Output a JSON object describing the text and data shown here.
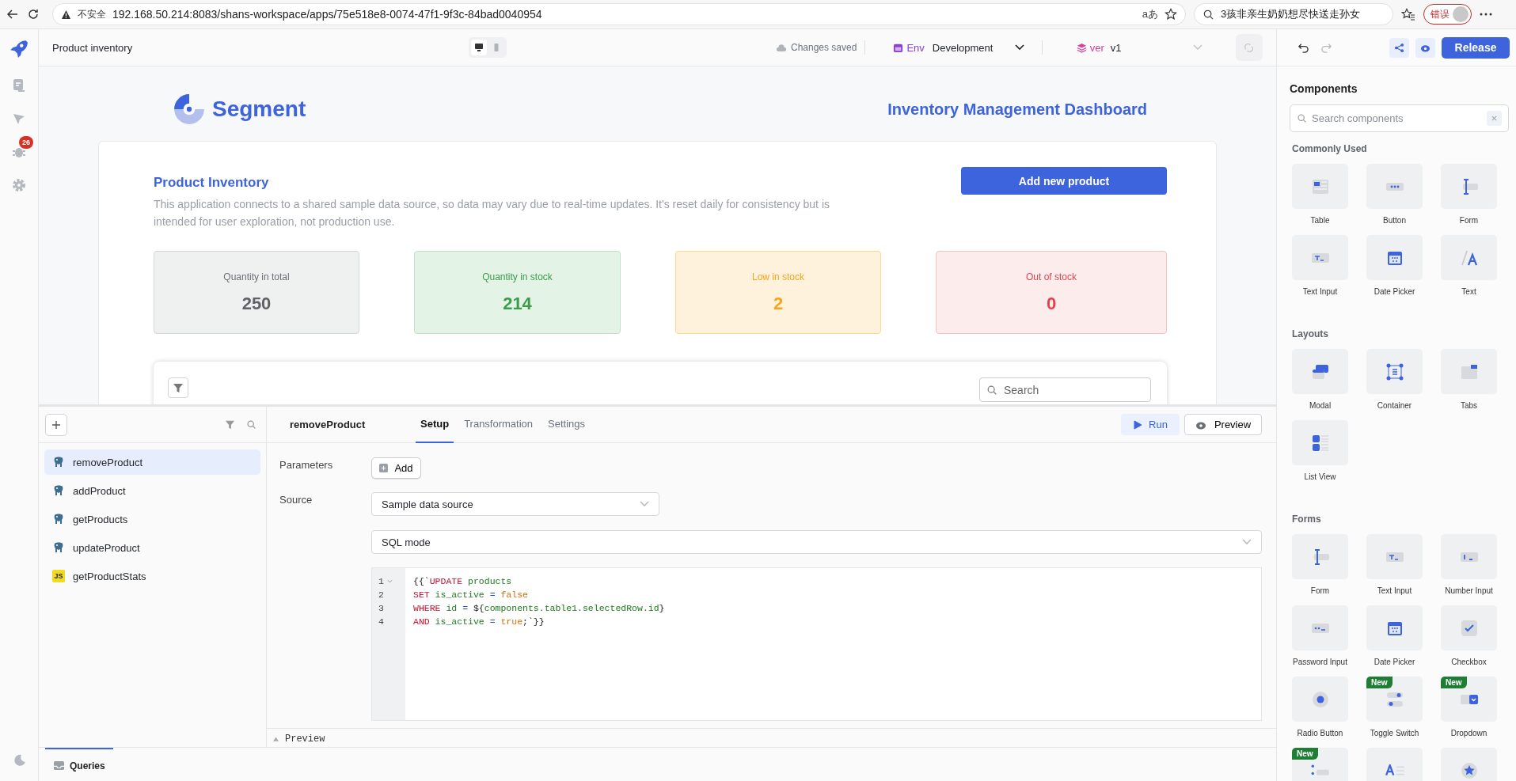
{
  "browser": {
    "security_label": "不安全",
    "url": "192.168.50.214:8083/shans-workspace/apps/75e518e8-0074-47f1-9f3c-84bad0040954",
    "reader_glyph": "aあ",
    "search_text": "3孩非亲生奶奶想尽快送走孙女",
    "profile_label": "错误"
  },
  "header": {
    "app_name": "Product inventory",
    "devices": [
      {
        "kind": "desktop",
        "selected": true
      },
      {
        "kind": "mobile",
        "selected": false
      }
    ],
    "save_status": "Changes saved",
    "env_label": "Env",
    "env_value": "Development",
    "version_label": "ver",
    "version_value": "v1",
    "release": "Release"
  },
  "rail": {
    "badge": "26"
  },
  "canvas": {
    "brand": "Segment",
    "dashboard_title": "Inventory Management Dashboard",
    "section_title": "Product Inventory",
    "description": "This application connects to a shared sample data source, so data may vary due to real-time updates. It's reset daily for consistency but is intended for user exploration, not production use.",
    "add_button": "Add new product",
    "stats": [
      {
        "kind": "neutral",
        "label": "Quantity in total",
        "value": "250"
      },
      {
        "kind": "success",
        "label": "Quantity in stock",
        "value": "214"
      },
      {
        "kind": "warning",
        "label": "Low in stock",
        "value": "2"
      },
      {
        "kind": "danger",
        "label": "Out of stock",
        "value": "0"
      }
    ],
    "search_placeholder": "Search"
  },
  "queries": {
    "items": [
      {
        "kind": "postgres",
        "name": "removeProduct",
        "selected": true
      },
      {
        "kind": "postgres",
        "name": "addProduct",
        "selected": false
      },
      {
        "kind": "postgres",
        "name": "getProducts",
        "selected": false
      },
      {
        "kind": "postgres",
        "name": "updateProduct",
        "selected": false
      },
      {
        "kind": "js",
        "icon_label": "JS",
        "name": "getProductStats",
        "selected": false
      }
    ],
    "active_query": "removeProduct",
    "tabs": [
      {
        "label": "Setup",
        "selected": true
      },
      {
        "label": "Transformation",
        "selected": false
      },
      {
        "label": "Settings",
        "selected": false
      }
    ],
    "run": "Run",
    "preview": "Preview",
    "parameters_label": "Parameters",
    "add_param": "Add",
    "source_label": "Source",
    "source_value": "Sample data source",
    "mode_value": "SQL mode",
    "code": [
      {
        "number": "1",
        "foldable": true,
        "tokens": [
          {
            "kind": "punct",
            "text": "{{`"
          },
          {
            "kind": "keyword",
            "text": "UPDATE"
          },
          {
            "kind": "ident",
            "text": " products"
          }
        ]
      },
      {
        "number": "2",
        "foldable": false,
        "tokens": [
          {
            "kind": "keyword",
            "text": "SET"
          },
          {
            "kind": "ident",
            "text": " is_active "
          },
          {
            "kind": "operator",
            "text": "="
          },
          {
            "kind": "literal",
            "text": " false"
          }
        ]
      },
      {
        "number": "3",
        "foldable": false,
        "tokens": [
          {
            "kind": "keyword",
            "text": "WHERE"
          },
          {
            "kind": "ident",
            "text": " id "
          },
          {
            "kind": "operator",
            "text": "="
          },
          {
            "kind": "punct",
            "text": " ${"
          },
          {
            "kind": "ident",
            "text": "components.table1.selectedRow.id"
          },
          {
            "kind": "punct",
            "text": "}"
          }
        ]
      },
      {
        "number": "4",
        "foldable": false,
        "tokens": [
          {
            "kind": "keyword",
            "text": "AND"
          },
          {
            "kind": "ident",
            "text": " is_active "
          },
          {
            "kind": "operator",
            "text": "="
          },
          {
            "kind": "literal",
            "text": " true"
          },
          {
            "kind": "punct",
            "text": ";`}}"
          }
        ]
      }
    ],
    "preview_bar": "Preview",
    "footer_tab": "Queries"
  },
  "components": {
    "title": "Components",
    "search_placeholder": "Search components",
    "sections": [
      {
        "title": "Commonly Used",
        "items": [
          {
            "kind": "table",
            "label": "Table"
          },
          {
            "kind": "button",
            "label": "Button"
          },
          {
            "kind": "form",
            "label": "Form"
          },
          {
            "kind": "text-input",
            "label": "Text Input"
          },
          {
            "kind": "date-picker",
            "label": "Date Picker"
          },
          {
            "kind": "text",
            "label": "Text"
          }
        ]
      },
      {
        "title": "Layouts",
        "items": [
          {
            "kind": "modal",
            "label": "Modal"
          },
          {
            "kind": "container",
            "label": "Container"
          },
          {
            "kind": "tabs",
            "label": "Tabs"
          },
          {
            "kind": "list-view",
            "label": "List View"
          }
        ]
      },
      {
        "title": "Forms",
        "items": [
          {
            "kind": "form",
            "label": "Form"
          },
          {
            "kind": "text-input",
            "label": "Text Input"
          },
          {
            "kind": "number-input",
            "label": "Number Input"
          },
          {
            "kind": "password-input",
            "label": "Password Input"
          },
          {
            "kind": "date-picker",
            "label": "Date Picker"
          },
          {
            "kind": "checkbox",
            "label": "Checkbox"
          },
          {
            "kind": "radio",
            "label": "Radio Button"
          },
          {
            "kind": "toggle",
            "label": "Toggle Switch",
            "badge": "New"
          },
          {
            "kind": "dropdown",
            "label": "Dropdown",
            "badge": "New"
          },
          {
            "kind": "multiselect",
            "badge": "New"
          },
          {
            "kind": "rich-text"
          },
          {
            "kind": "rating"
          }
        ]
      }
    ]
  }
}
